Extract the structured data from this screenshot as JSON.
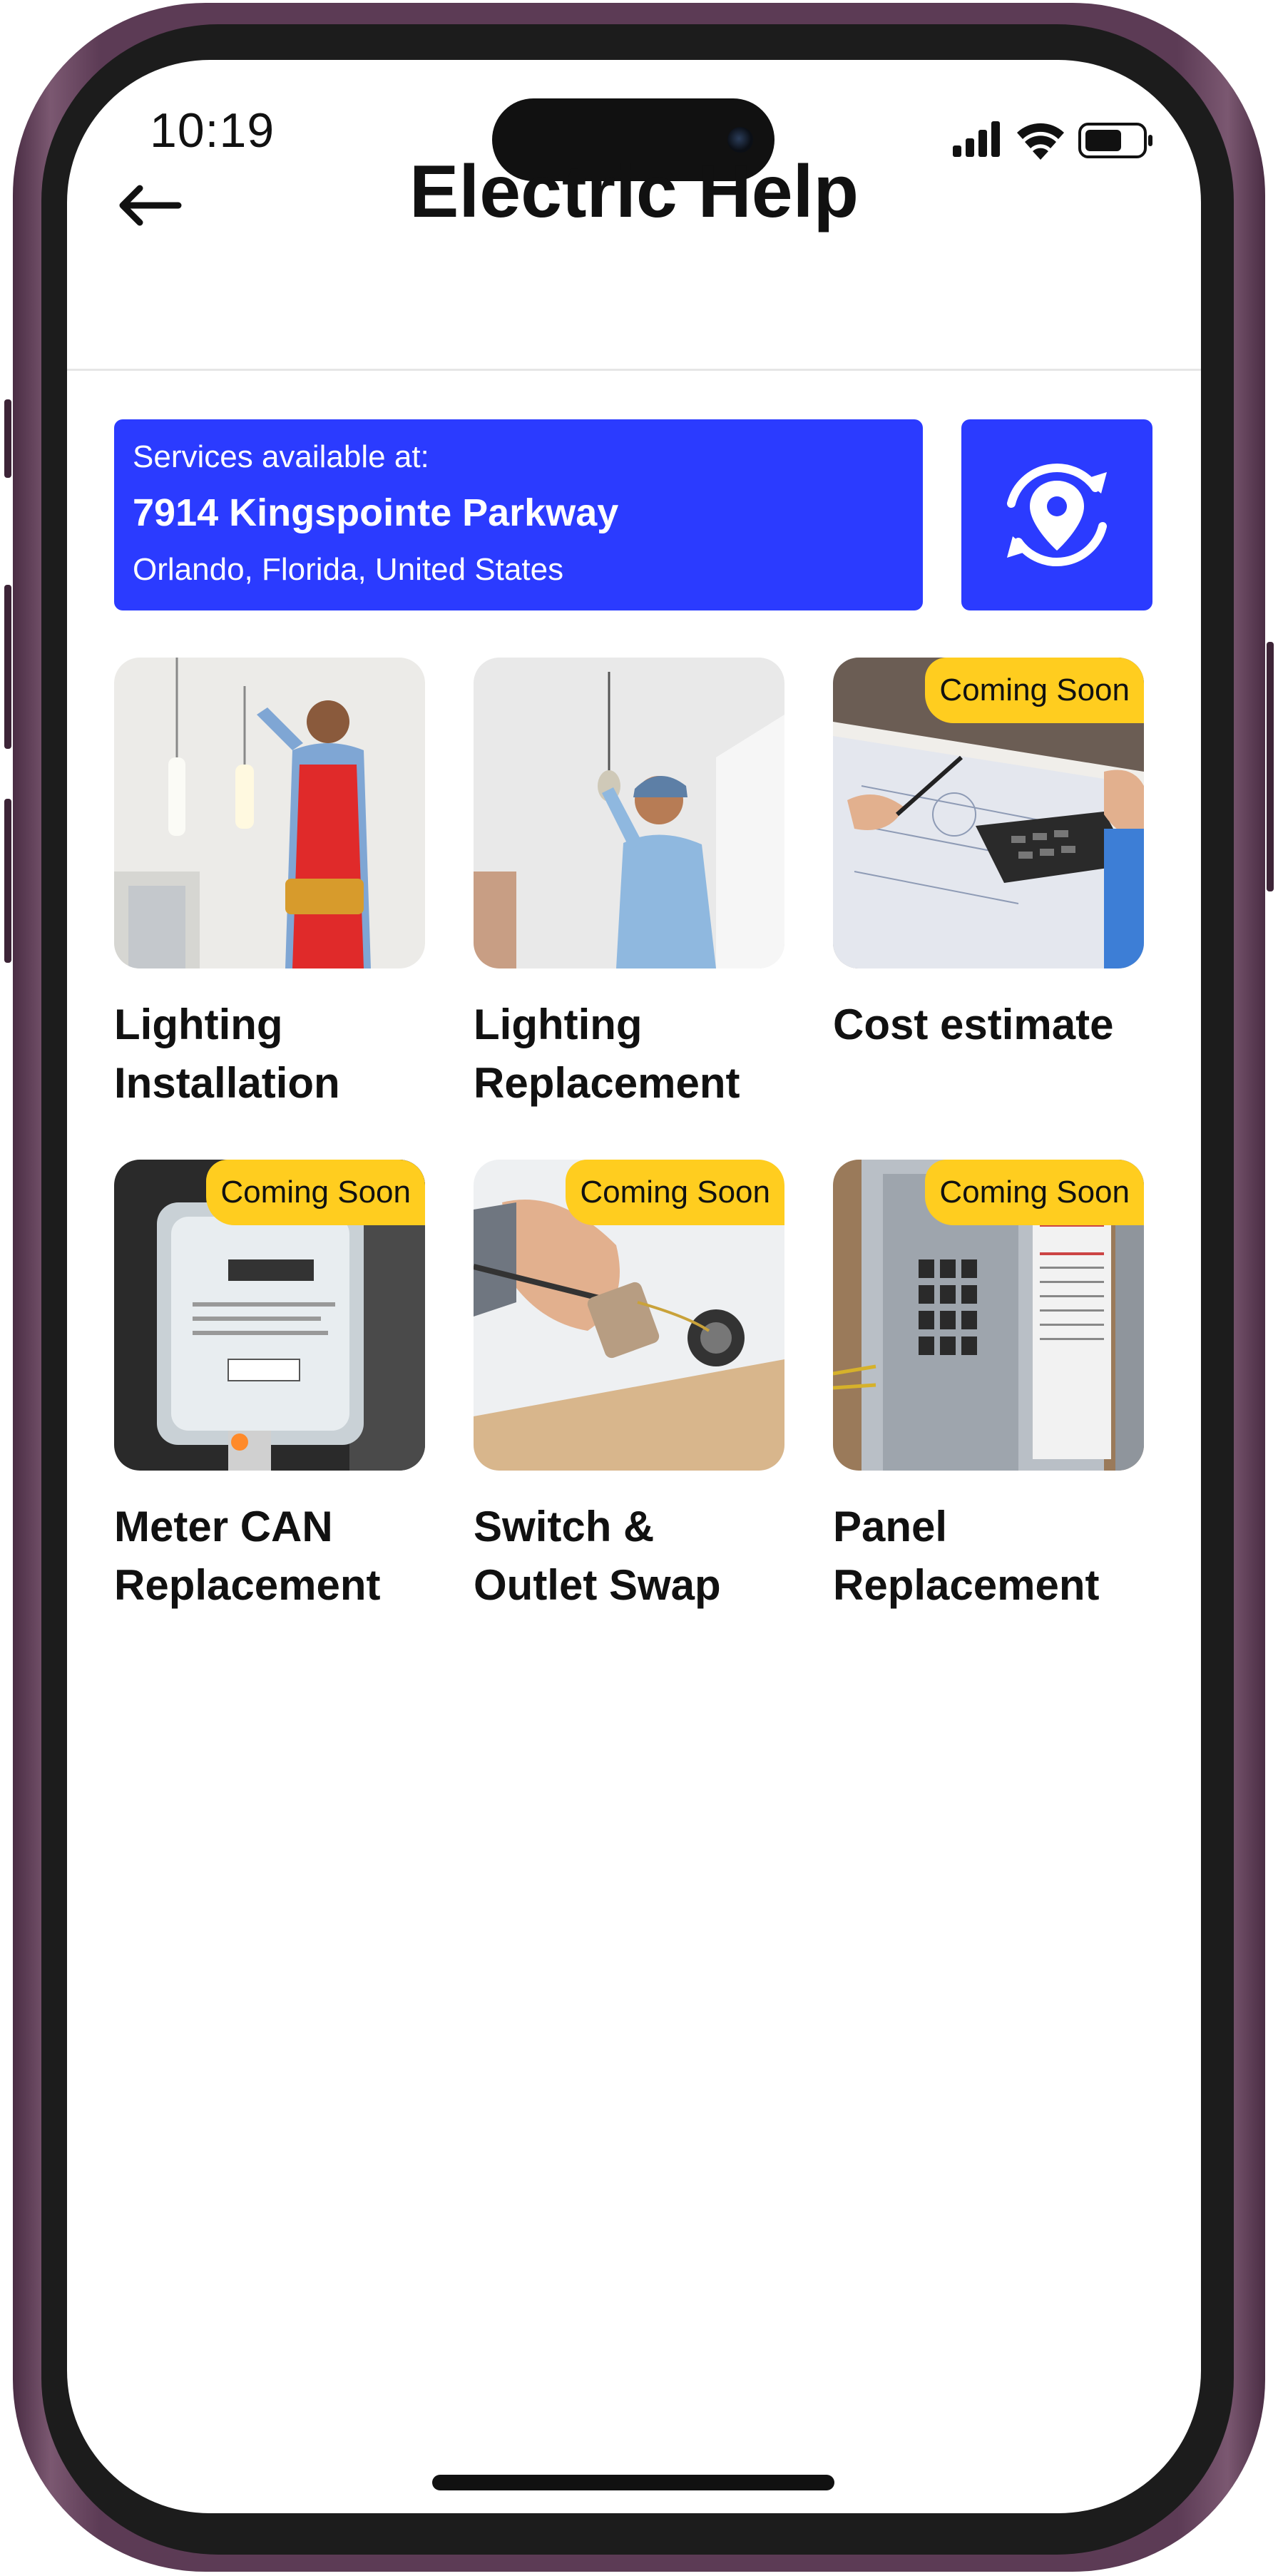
{
  "status_bar": {
    "time": "10:19"
  },
  "header": {
    "title": "Electric Help"
  },
  "location": {
    "label": "Services available at:",
    "line1": "7914 Kingspointe Parkway",
    "line2": "Orlando, Florida, United States"
  },
  "services": [
    {
      "name": "Lighting Installation",
      "badge": ""
    },
    {
      "name": "Lighting Replacement",
      "badge": ""
    },
    {
      "name": "Cost estimate",
      "badge": "Coming Soon"
    },
    {
      "name": "Meter CAN Replacement",
      "badge": "Coming Soon"
    },
    {
      "name": "Switch & Outlet Swap",
      "badge": "Coming Soon"
    },
    {
      "name": "Panel Replacement",
      "badge": "Coming Soon"
    }
  ],
  "colors": {
    "primary": "#2b3bff",
    "badge": "#ffcd1f",
    "text": "#111111"
  },
  "icons": [
    "back-arrow-icon",
    "location-refresh-icon",
    "signal-icon",
    "wifi-icon",
    "battery-icon"
  ]
}
